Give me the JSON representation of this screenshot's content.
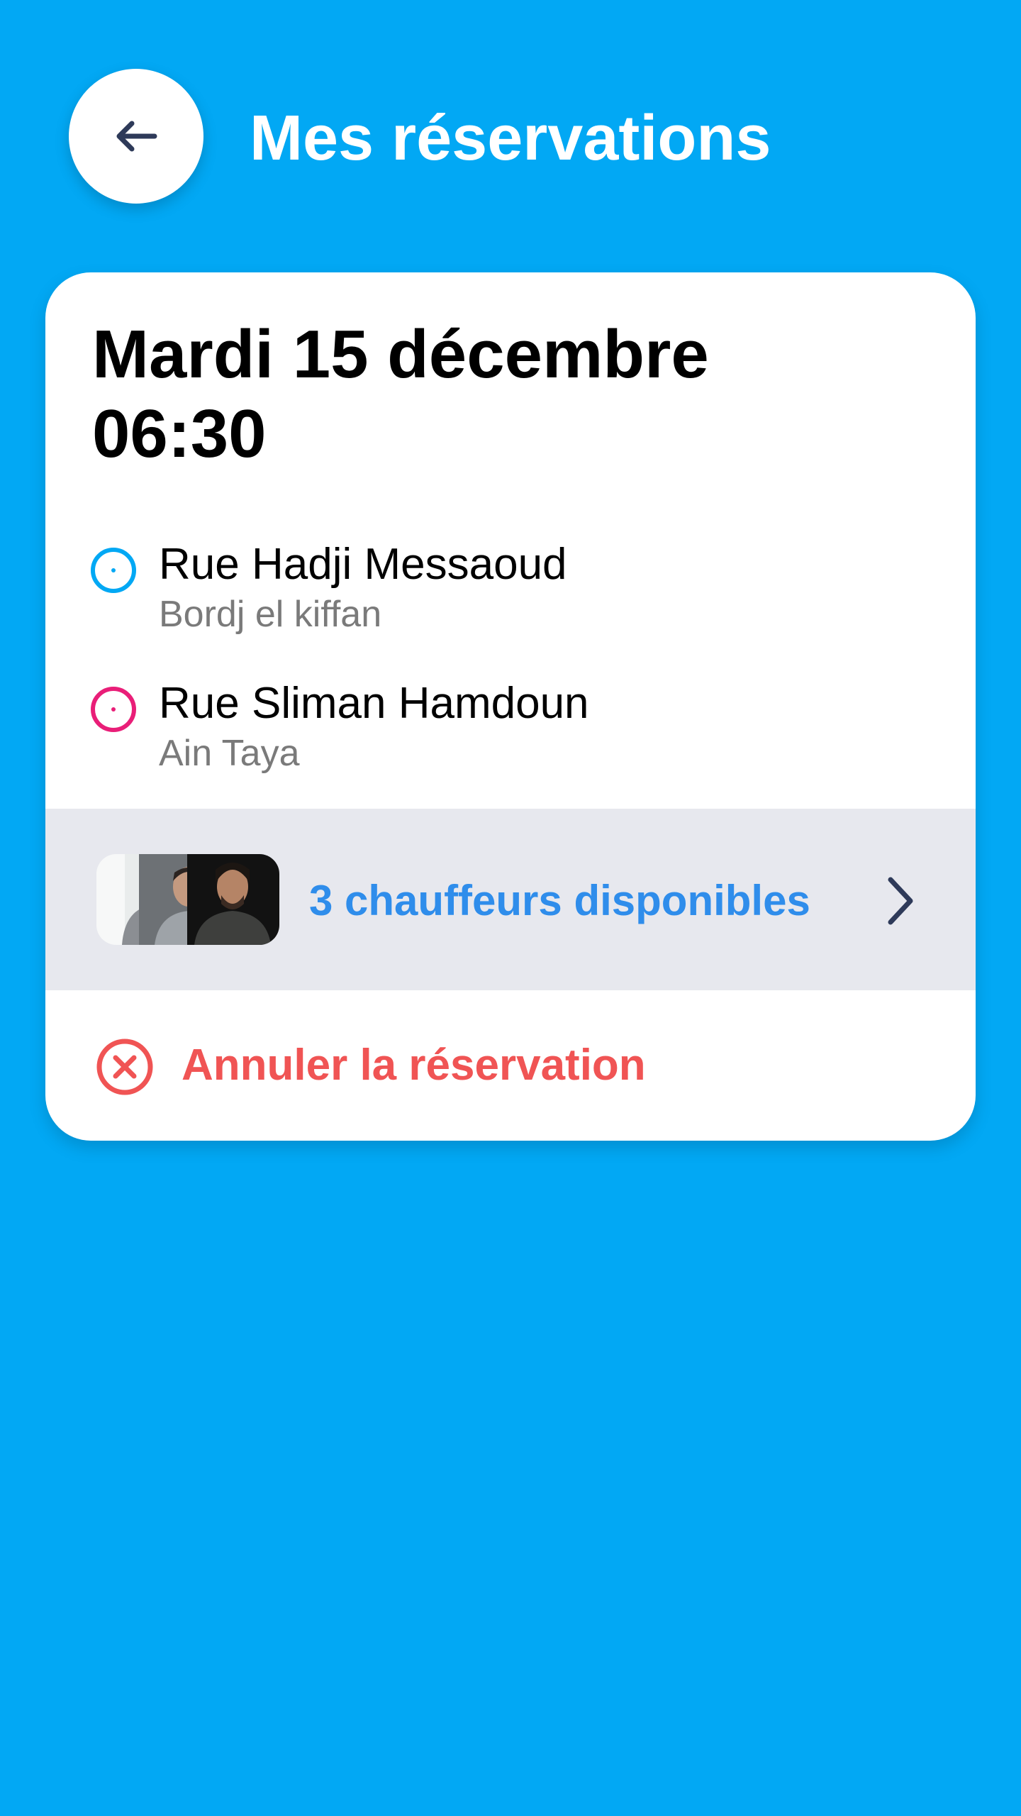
{
  "header": {
    "title": "Mes réservations",
    "back_icon": "arrow-left-icon"
  },
  "booking": {
    "date": "Mardi 15 décembre",
    "time": "06:30",
    "pickup": {
      "street": "Rue Hadji Messaoud",
      "city": "Bordj el kiffan",
      "color": "#02A8F4"
    },
    "dropoff": {
      "street": "Rue Sliman Hamdoun",
      "city": "Ain Taya",
      "color": "#E91E78"
    },
    "drivers": {
      "label": "3 chauffeurs disponibles",
      "count": 3,
      "color": "#2F8DEB"
    },
    "cancel": {
      "label": "Annuler la réservation",
      "color": "#F05454"
    }
  },
  "colors": {
    "background": "#02A8F4",
    "card": "#FFFFFF",
    "drivers_row": "#E7E8EE",
    "icon_dark": "#2E3A59"
  }
}
